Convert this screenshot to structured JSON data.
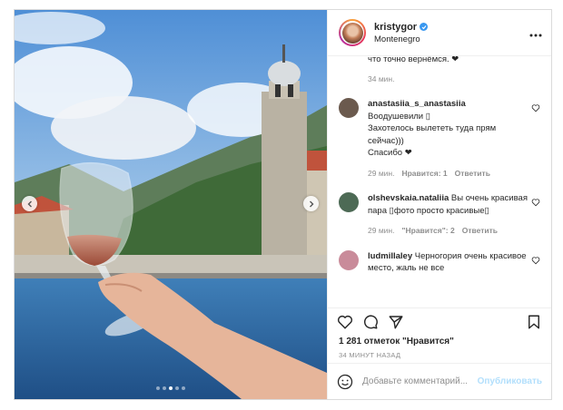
{
  "post": {
    "username": "kristygor",
    "location": "Montenegro",
    "more_icon": "more-horizontal-icon",
    "carousel": {
      "total": 5,
      "active": 3
    }
  },
  "comments": {
    "caption_tail": "что точно вернёмся. ❤",
    "caption_time": "34 мин.",
    "items": [
      {
        "user": "anastasiia_s_anastasiia",
        "text_lines": [
          "Воодушевили ▯",
          "Захотелось вылететь туда прям сейчас)))",
          "Спасибо ❤"
        ],
        "time": "29 мин.",
        "likes": "Нравится: 1",
        "reply": "Ответить",
        "avatar_color": "#6b5a4e"
      },
      {
        "user": "olshevskaia.nataliia",
        "text_inline": "Вы очень красивая пара ▯фото просто красивые▯",
        "time": "29 мин.",
        "likes": "\"Нравится\": 2",
        "reply": "Ответить",
        "avatar_color": "#4d6a55"
      },
      {
        "user": "ludmillaley",
        "text_inline": "Черногория очень красивое место, жаль не все",
        "avatar_color": "#c98b9a"
      }
    ]
  },
  "actions": {
    "like_icon": "heart-icon",
    "comment_icon": "comment-icon",
    "share_icon": "paper-plane-icon",
    "save_icon": "bookmark-icon"
  },
  "likes_text": "1 281 отметок \"Нравится\"",
  "time_ago": "34 МИНУТ НАЗАД",
  "add_comment": {
    "placeholder": "Добавьте комментарий...",
    "publish_label": "Опубликовать",
    "emoji_icon": "smiley-icon"
  },
  "colors": {
    "accent": "#3897f0",
    "publish_disabled": "#b2dffc",
    "muted": "#8e8e8e",
    "border": "#dbdbdb"
  }
}
